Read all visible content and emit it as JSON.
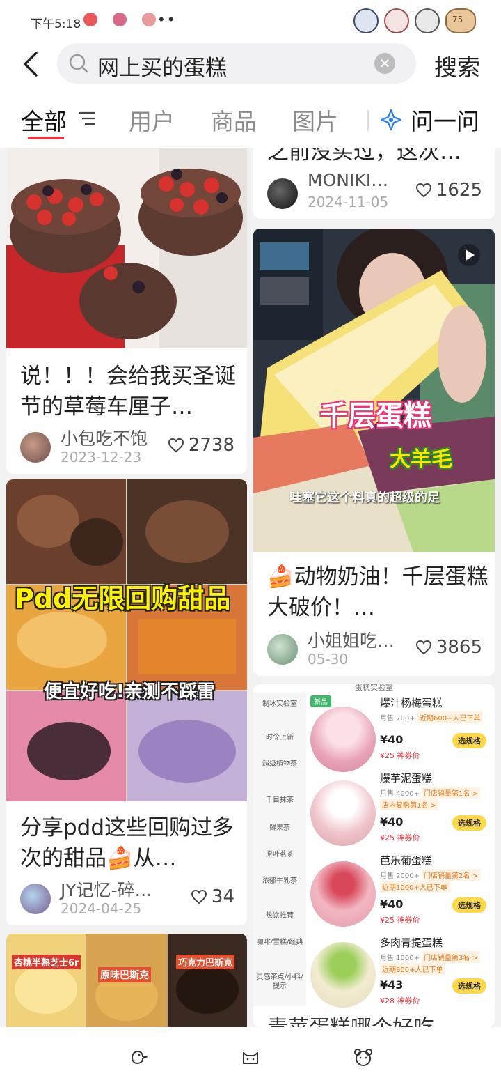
{
  "status_bar": {
    "time": "下午5:18",
    "dots": "••",
    "badge_count": "75"
  },
  "header": {
    "search_query": "网上买的蛋糕",
    "clear_symbol": "✕",
    "search_button": "搜索"
  },
  "tabs": {
    "all": "全部",
    "users": "用户",
    "products": "商品",
    "images": "图片",
    "ask": "问一问"
  },
  "feed": {
    "cards": [
      {
        "title": "说！！！会给我买圣诞节的草莓车厘子…",
        "author": "小包吃不饱",
        "date": "2023-12-23",
        "likes": "2738"
      },
      {
        "title": "分享pdd这些回购过多次的甜品🍰从…",
        "author": "JY记忆-碎…",
        "date": "2024-04-25",
        "likes": "34",
        "overlay_title": "Pdd无限回购甜品",
        "overlay_sub": "便宜好吃!亲测不踩雷"
      },
      {
        "title_partial": "之前没买过，这次…",
        "author": "MONIKI…",
        "date": "2024-11-05",
        "likes": "1625"
      },
      {
        "title": "🍰动物奶油！千层蛋糕大破价！…",
        "author": "小姐姐吃…",
        "date": "05-30",
        "likes": "3865",
        "overlay_title": "千层蛋糕",
        "overlay_tag": "大羊毛",
        "overlay_caption": "哇塞它这个料真的超级的足"
      },
      {
        "partial_labels": [
          "杏桃半熟芝士6r",
          "原味巴斯克",
          "巧克力巴斯克"
        ]
      }
    ],
    "menu_card": {
      "header_partial": "蛋糕实验室",
      "bottom_partial": "青苹蛋糕哪个好吃",
      "sidebar": [
        "制冰实验室",
        "时令上新",
        "超级植物茶",
        "千目抹茶",
        "鲜果茶",
        "原叶茗茶",
        "浓郁牛乳茶",
        "热饮推荐",
        "咖啡/雪糕/经典",
        "灵感茶点/小料/提示"
      ],
      "products": [
        {
          "badge": "新品",
          "name": "爆汁杨梅蛋糕",
          "sales": "月售 700+",
          "rank": "近期600+人已下单",
          "rank2": "",
          "price": "¥40",
          "coupon": "¥25 神券价",
          "spec": "选规格"
        },
        {
          "badge": "",
          "name": "爆芋泥蛋糕",
          "sales": "月售 4000+",
          "rank": "门店销量第1名 >",
          "rank2": "店内复购第1名 >",
          "price": "¥40",
          "coupon": "¥25 神券价",
          "spec": "选规格"
        },
        {
          "badge": "",
          "name": "芭乐葡蛋糕",
          "sales": "月售 2000+",
          "rank": "门店销量第2名 >",
          "rank2": "近期1000+人已下单",
          "price": "¥40",
          "coupon": "¥25 神券价",
          "spec": "选规格"
        },
        {
          "badge": "",
          "name": "多肉青提蛋糕",
          "sales": "月售 1000+",
          "rank": "门店销量第3名 >",
          "rank2": "近期800+人已下单",
          "price": "¥43",
          "coupon": "¥28 神券价",
          "spec": "选规格"
        }
      ]
    }
  },
  "colors": {
    "accent_red": "#e8343a",
    "spec_yellow": "#ffd84a"
  },
  "icons": [
    "back-icon",
    "search-icon",
    "clear-icon",
    "filter-icon",
    "ask-icon",
    "heart-icon",
    "play-icon",
    "bottom-duck-icon",
    "bottom-cat-icon",
    "bottom-bear-icon"
  ]
}
